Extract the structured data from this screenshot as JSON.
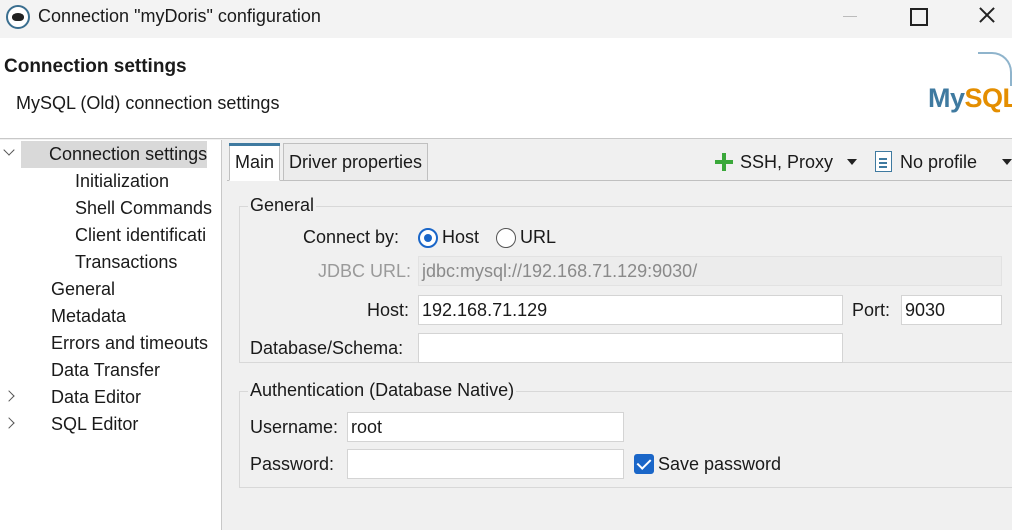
{
  "window": {
    "title": "Connection \"myDoris\" configuration",
    "app_icon": "dbeaver-beaver-icon",
    "controls": [
      "minimize",
      "maximize",
      "close"
    ]
  },
  "header": {
    "title": "Connection settings",
    "subtitle": "MySQL (Old) connection settings",
    "logo": {
      "prefix": "My",
      "suffix": "SQL"
    }
  },
  "nav": {
    "items": [
      {
        "label": "Connection settings",
        "expander": "expanded",
        "selected": true
      },
      {
        "label": "Initialization"
      },
      {
        "label": "Shell Commands"
      },
      {
        "label": "Client identificati"
      },
      {
        "label": "Transactions"
      },
      {
        "label": "General"
      },
      {
        "label": "Metadata"
      },
      {
        "label": "Errors and timeouts"
      },
      {
        "label": "Data Transfer"
      },
      {
        "label": "Data Editor",
        "expander": "collapsed"
      },
      {
        "label": "SQL Editor",
        "expander": "collapsed"
      }
    ]
  },
  "tabs": [
    {
      "label": "Main",
      "active": true
    },
    {
      "label": "Driver properties",
      "active": false
    }
  ],
  "toolbar": {
    "ssh_label": "SSH, Proxy",
    "profile_label": "No profile",
    "accent": "#3aa83a"
  },
  "general": {
    "title": "General",
    "connect_by_label": "Connect by:",
    "connect_options": [
      {
        "label": "Host",
        "checked": true
      },
      {
        "label": "URL",
        "checked": false
      }
    ],
    "jdbc_label": "JDBC URL:",
    "jdbc_value": "jdbc:mysql://192.168.71.129:9030/",
    "host_label": "Host:",
    "host_value": "192.168.71.129",
    "port_label": "Port:",
    "port_value": "9030",
    "database_label": "Database/Schema:",
    "database_value": ""
  },
  "auth": {
    "title": "Authentication (Database Native)",
    "username_label": "Username:",
    "username_value": "root",
    "password_label": "Password:",
    "password_value": "",
    "save_password_label": "Save password",
    "save_password_checked": true
  },
  "colors": {
    "accent": "#1a66c8",
    "logo_blue": "#3f7aa0",
    "logo_orange": "#e48e00"
  }
}
